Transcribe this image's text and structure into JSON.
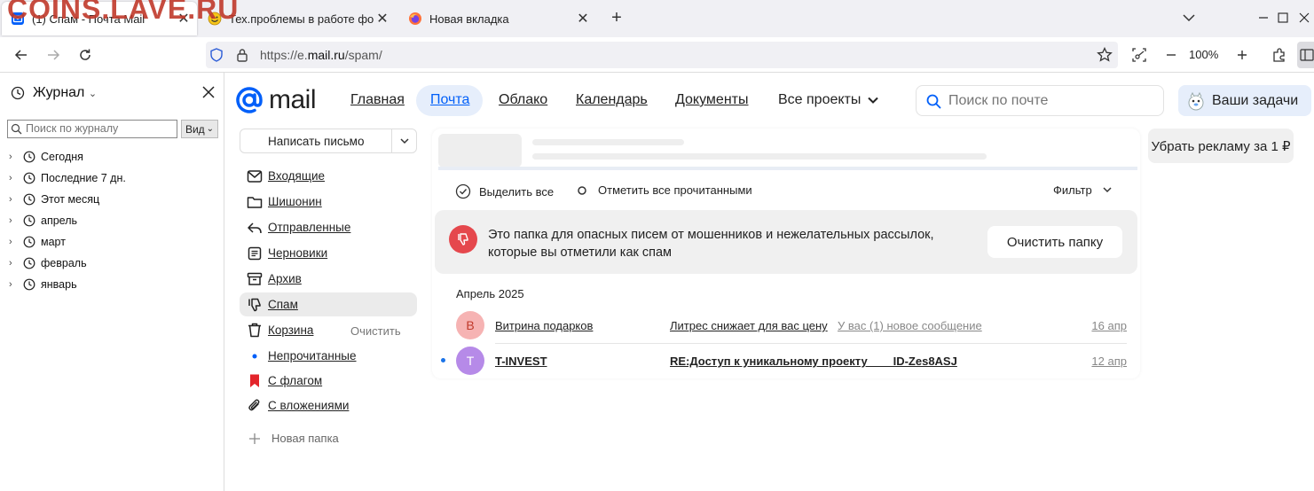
{
  "browser": {
    "watermark": "COINS.LAVE.RU",
    "tabs": [
      {
        "title": "(1) Спам - Почта Mail",
        "active": true
      },
      {
        "title": "Тех.проблемы в работе форума",
        "active": false
      },
      {
        "title": "Новая вкладка",
        "active": false
      }
    ],
    "new_tab_symbol": "+",
    "url_prefix": "https://e.",
    "url_host": "mail.ru",
    "url_path": "/spam/",
    "zoom": "100%"
  },
  "journal": {
    "title": "Журнал",
    "search_placeholder": "Поиск по журналу",
    "view_label": "Вид",
    "items": [
      "Сегодня",
      "Последние 7 дн.",
      "Этот месяц",
      "апрель",
      "март",
      "февраль",
      "январь"
    ]
  },
  "mail": {
    "logo_text": "mail",
    "nav": [
      "Главная",
      "Почта",
      "Облако",
      "Календарь",
      "Документы",
      "Все проекты"
    ],
    "active_nav": "Почта",
    "search_placeholder": "Поиск по почте",
    "tasks_label": "Ваши задачи",
    "compose_label": "Написать письмо",
    "folders": [
      {
        "label": "Входящие",
        "icon": "inbox-icon"
      },
      {
        "label": "Шишонин",
        "icon": "folder-icon"
      },
      {
        "label": "Отправленные",
        "icon": "sent-icon"
      },
      {
        "label": "Черновики",
        "icon": "drafts-icon"
      },
      {
        "label": "Архив",
        "icon": "archive-icon"
      },
      {
        "label": "Спам",
        "icon": "spam-icon",
        "active": true
      },
      {
        "label": "Корзина",
        "icon": "trash-icon"
      },
      {
        "label": "Непрочитанные",
        "icon": "unread-dot-icon"
      },
      {
        "label": "С флагом",
        "icon": "flag-icon"
      },
      {
        "label": "С вложениями",
        "icon": "attachment-icon"
      }
    ],
    "clean_trash_label": "Очистить",
    "new_folder_label": "Новая папка",
    "toolbar": {
      "select_all": "Выделить все",
      "mark_all_read": "Отметить все прочитанными",
      "filter": "Фильтр"
    },
    "banner": {
      "text": "Это папка для опасных писем от мошенников и нежелательных рассылок, которые вы отметили как спам",
      "button": "Очистить папку"
    },
    "month_header": "Апрель 2025",
    "messages": [
      {
        "avatar_letter": "В",
        "avatar_bg": "#f6b3b3",
        "avatar_fg": "#c0392b",
        "sender": "Витрина подарков",
        "subject": "Литрес снижает для вас цену",
        "snippet": "У вас (1) новое сообщение",
        "date": "16 апр",
        "unread": false
      },
      {
        "avatar_letter": "T",
        "avatar_bg": "#b68ae8",
        "avatar_fg": "#ffffff",
        "sender": "T-INVEST",
        "subject": "RE:Доступ к уникальному проекту ___ ID-Zes8ASJ",
        "snippet": "",
        "date": "12 апр",
        "unread": true
      }
    ],
    "ad_label": "Убрать рекламу за 1 ₽"
  },
  "colors": {
    "accent": "#005ff9",
    "spam_red": "#e5484d",
    "flag_red": "#e3242b"
  }
}
